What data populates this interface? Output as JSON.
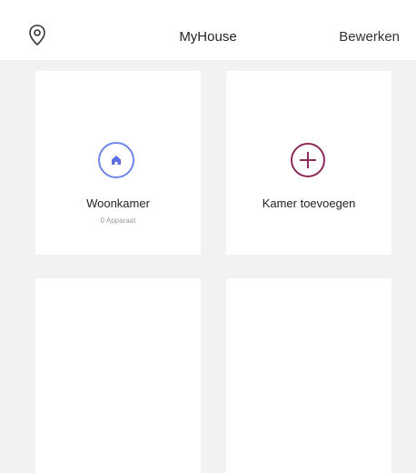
{
  "header": {
    "location_icon": "location-pin-icon",
    "title": "MyHouse",
    "edit_label": "Bewerken"
  },
  "rooms": [
    {
      "name": "Woonkamer",
      "subtitle": "0 Apparaat",
      "icon": "home-icon",
      "icon_color": "#5b6fe0"
    },
    {
      "name": "Kamer toevoegen",
      "icon": "add-circle-icon",
      "icon_color": "#8e2a5a"
    }
  ],
  "colors": {
    "background": "#f2f2f2",
    "card": "#ffffff"
  }
}
